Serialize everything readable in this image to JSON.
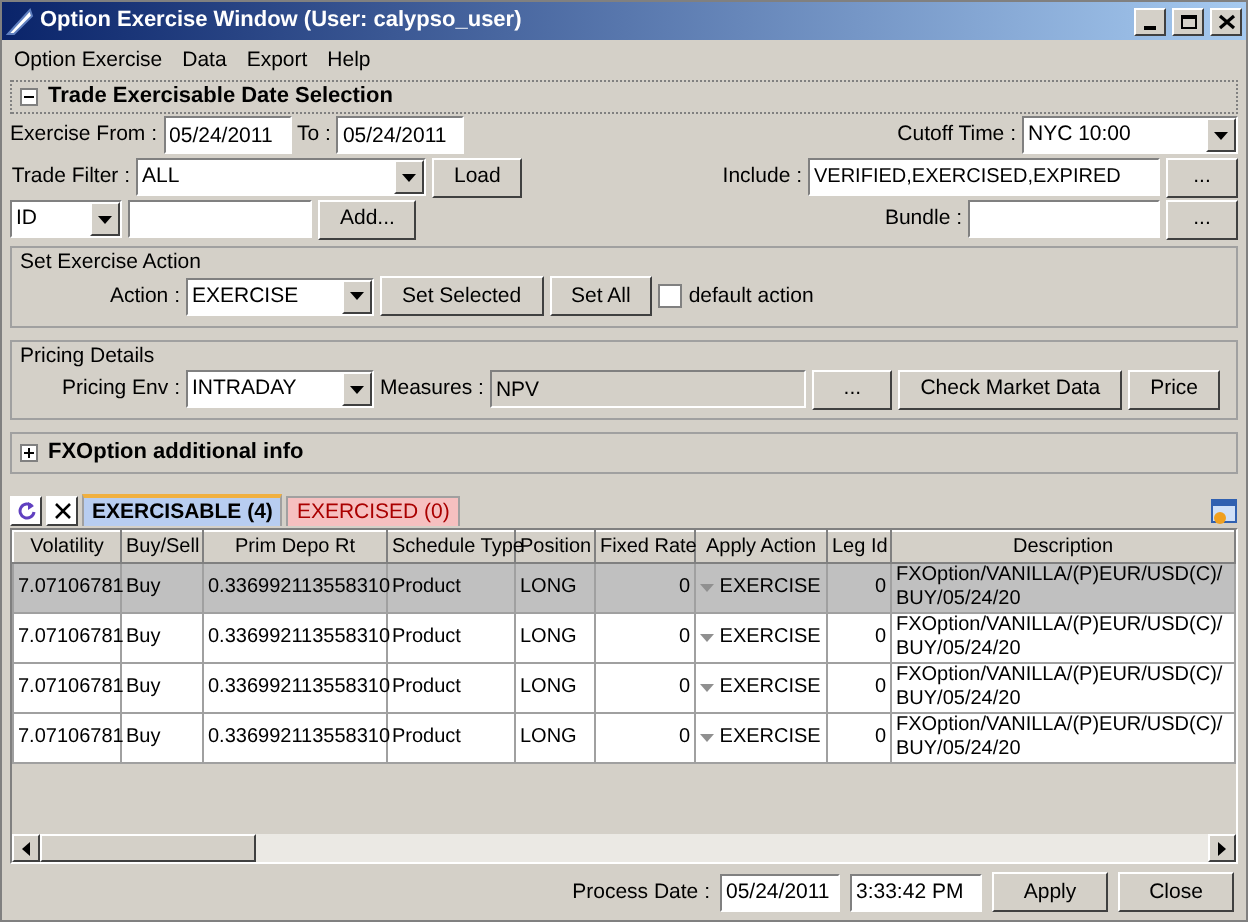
{
  "window": {
    "title": "Option Exercise Window (User: calypso_user)"
  },
  "menu": [
    "Option Exercise",
    "Data",
    "Export",
    "Help"
  ],
  "trade_selection": {
    "title": "Trade Exercisable Date Selection",
    "expanded": true,
    "exercise_from_label": "Exercise From :",
    "exercise_from": "05/24/2011",
    "to_label": "To :",
    "to": "05/24/2011",
    "cutoff_label": "Cutoff Time :",
    "cutoff": "NYC 10:00",
    "trade_filter_label": "Trade Filter :",
    "trade_filter": "ALL",
    "load_button": "Load",
    "include_label": "Include :",
    "include": "VERIFIED,EXERCISED,EXPIRED",
    "include_button": "...",
    "id_type": "ID",
    "add_button": "Add...",
    "bundle_label": "Bundle :",
    "bundle_button": "..."
  },
  "exercise_action": {
    "legend": "Set Exercise Action",
    "action_label": "Action :",
    "action": "EXERCISE",
    "buttons": [
      "Set Selected",
      "Set All"
    ],
    "default_action": {
      "label": "default action",
      "checked": false
    }
  },
  "pricing": {
    "legend": "Pricing Details",
    "env_label": "Pricing Env :",
    "env": "INTRADAY",
    "measures_label": "Measures :",
    "measures": "NPV",
    "buttons": [
      "...",
      "Check Market Data",
      "Price"
    ]
  },
  "fx_info": {
    "title": "FXOption additional info",
    "expanded": false
  },
  "tabs": [
    {
      "label": "EXERCISABLE (4)",
      "selected": true
    },
    {
      "label": "EXERCISED (0)",
      "selected": false
    }
  ],
  "table": {
    "columns": [
      "Volatility",
      "Buy/Sell",
      "Prim Depo Rt",
      "Schedule Type",
      "Position",
      "Fixed Rate",
      "Apply Action",
      "Leg Id",
      "Description"
    ],
    "rows": [
      {
        "selected": true,
        "cells": [
          "7.07106781",
          "Buy",
          "0.336992113558310",
          "Product",
          "LONG",
          "0",
          "EXERCISE",
          "0",
          "FXOption/VANILLA/(P)EUR/USD(C)/BUY/05/24/20"
        ]
      },
      {
        "selected": false,
        "cells": [
          "7.07106781",
          "Buy",
          "0.336992113558310",
          "Product",
          "LONG",
          "0",
          "EXERCISE",
          "0",
          "FXOption/VANILLA/(P)EUR/USD(C)/BUY/05/24/20"
        ]
      },
      {
        "selected": false,
        "cells": [
          "7.07106781",
          "Buy",
          "0.336992113558310",
          "Product",
          "LONG",
          "0",
          "EXERCISE",
          "0",
          "FXOption/VANILLA/(P)EUR/USD(C)/BUY/05/24/20"
        ]
      },
      {
        "selected": false,
        "cells": [
          "7.07106781",
          "Buy",
          "0.336992113558310",
          "Product",
          "LONG",
          "0",
          "EXERCISE",
          "0",
          "FXOption/VANILLA/(P)EUR/USD(C)/BUY/05/24/20"
        ]
      }
    ]
  },
  "footer": {
    "process_date_label": "Process Date :",
    "date": "05/24/2011",
    "time": "3:33:42 PM",
    "buttons": [
      "Apply",
      "Close"
    ]
  }
}
